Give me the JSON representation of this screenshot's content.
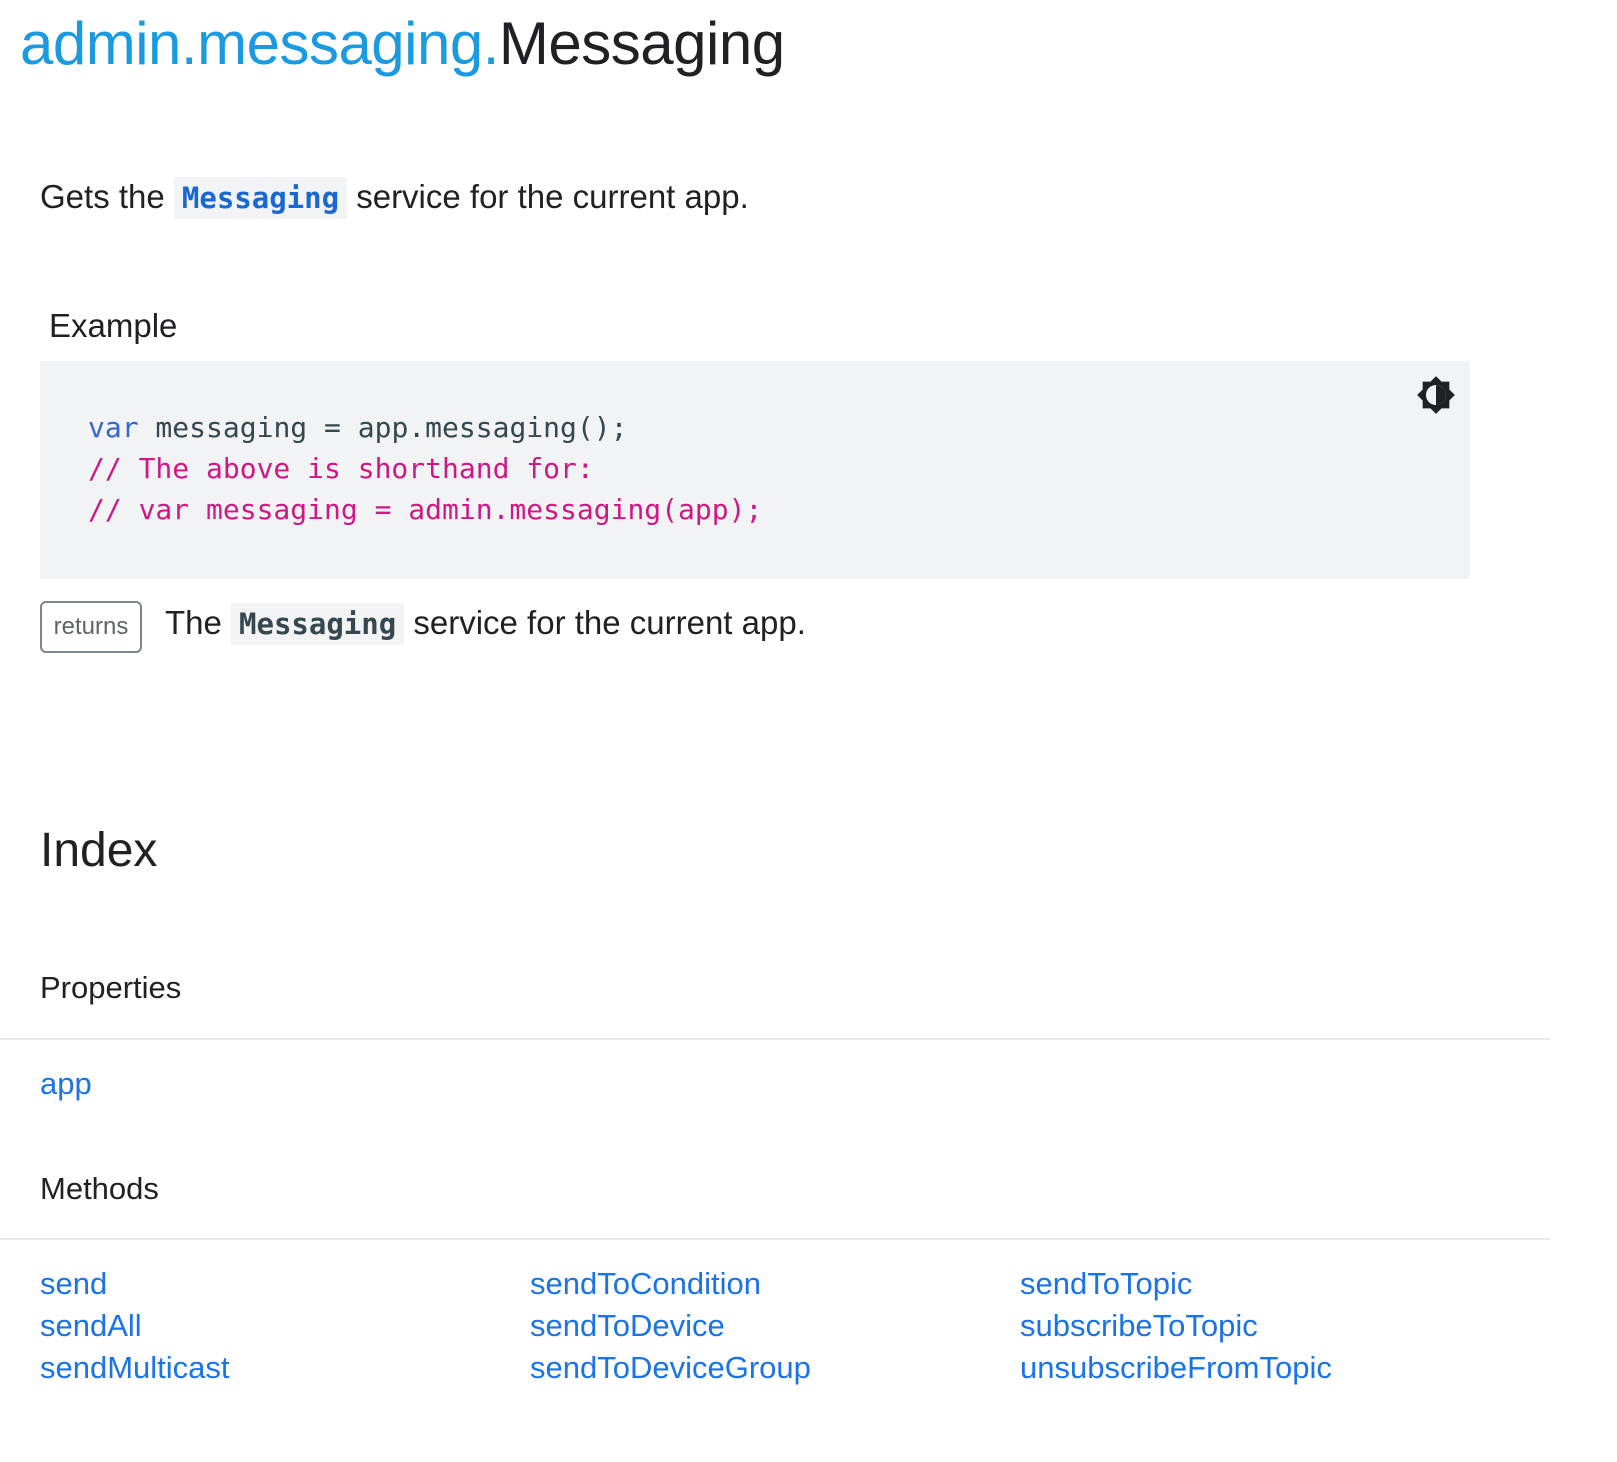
{
  "title": {
    "prefix": "admin.messaging.",
    "name": "Messaging"
  },
  "description": {
    "before": "Gets the ",
    "code": "Messaging",
    "after": " service for the current app."
  },
  "example": {
    "label": "Example",
    "code_lines": [
      {
        "kw": "var",
        "rest": " messaging = app.messaging();"
      },
      {
        "comment": "// The above is shorthand for:"
      },
      {
        "comment": "// var messaging = admin.messaging(app);"
      }
    ],
    "theme_toggle_icon": "brightness-contrast-icon"
  },
  "returns": {
    "badge": "returns",
    "before": "The ",
    "code": "Messaging",
    "after": " service for the current app."
  },
  "index": {
    "heading": "Index",
    "properties": {
      "label": "Properties",
      "items": [
        "app"
      ]
    },
    "methods": {
      "label": "Methods",
      "items": [
        "send",
        "sendAll",
        "sendMulticast",
        "sendToCondition",
        "sendToDevice",
        "sendToDeviceGroup",
        "sendToTopic",
        "subscribeToTopic",
        "unsubscribeFromTopic"
      ]
    }
  },
  "colors": {
    "link": "#1a73e8",
    "title_prefix": "#1a9ae0",
    "code_keyword": "#3367d6",
    "code_comment": "#d01884",
    "code_bg": "#f1f3f4",
    "divider": "#e8eaed"
  }
}
